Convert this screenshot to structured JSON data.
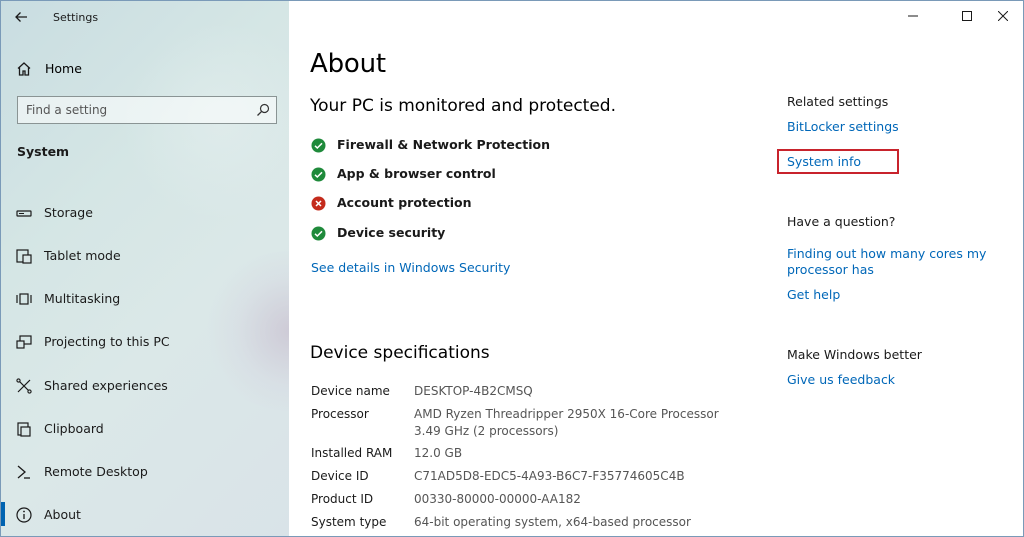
{
  "window": {
    "title": "Settings",
    "colors": {
      "accent": "#0063b1",
      "link": "#0067b8",
      "success": "#1f8a3b",
      "error": "#c42b1c",
      "highlight": "#c8232c"
    }
  },
  "sidebar": {
    "home_label": "Home",
    "search_placeholder": "Find a setting",
    "section_label": "System",
    "items": [
      {
        "label": "Storage",
        "icon": "storage-icon"
      },
      {
        "label": "Tablet mode",
        "icon": "tablet-mode-icon"
      },
      {
        "label": "Multitasking",
        "icon": "multitasking-icon"
      },
      {
        "label": "Projecting to this PC",
        "icon": "projecting-icon"
      },
      {
        "label": "Shared experiences",
        "icon": "shared-experiences-icon"
      },
      {
        "label": "Clipboard",
        "icon": "clipboard-icon"
      },
      {
        "label": "Remote Desktop",
        "icon": "remote-desktop-icon"
      },
      {
        "label": "About",
        "icon": "info-icon",
        "selected": true
      }
    ]
  },
  "main": {
    "title": "About",
    "protection_heading": "Your PC is monitored and protected.",
    "statuses": [
      {
        "label": "Firewall & Network Protection",
        "state": "ok"
      },
      {
        "label": "App & browser control",
        "state": "ok"
      },
      {
        "label": "Account protection",
        "state": "error"
      },
      {
        "label": "Device security",
        "state": "ok"
      }
    ],
    "see_details_link": "See details in Windows Security",
    "specs_heading": "Device specifications",
    "specs": {
      "device_name": {
        "label": "Device name",
        "value": "DESKTOP-4B2CMSQ"
      },
      "processor": {
        "label": "Processor",
        "value_line1": "AMD Ryzen Threadripper 2950X 16-Core Processor",
        "value_line2": "3.49 GHz  (2 processors)"
      },
      "installed_ram": {
        "label": "Installed RAM",
        "value": "12.0 GB"
      },
      "device_id": {
        "label": "Device ID",
        "value": "C71AD5D8-EDC5-4A93-B6C7-F35774605C4B"
      },
      "product_id": {
        "label": "Product ID",
        "value": "00330-80000-00000-AA182"
      },
      "system_type": {
        "label": "System type",
        "value": "64-bit operating system, x64-based processor"
      }
    }
  },
  "right_panel": {
    "related_heading": "Related settings",
    "bitlocker_link": "BitLocker settings",
    "system_info_link": "System info",
    "question_heading": "Have a question?",
    "cores_link_line1": "Finding out how many cores my",
    "cores_link_line2": "processor has",
    "get_help_link": "Get help",
    "better_heading": "Make Windows better",
    "feedback_link": "Give us feedback"
  }
}
